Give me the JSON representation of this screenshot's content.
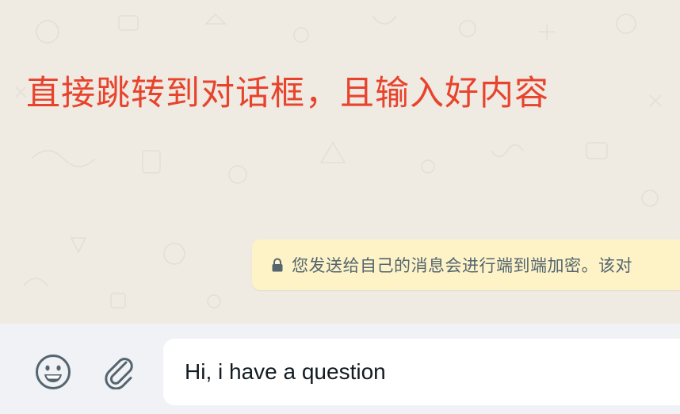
{
  "annotation": {
    "text": "直接跳转到对话框，且输入好内容",
    "color": "#e8432d"
  },
  "system_notice": {
    "icon": "lock-icon",
    "text": "您发送给自己的消息会进行端到端加密。该对"
  },
  "composer": {
    "emoji_icon": "emoji-icon",
    "attach_icon": "paperclip-icon",
    "message_value": "Hi, i have a question"
  },
  "colors": {
    "chat_background": "#efeae2",
    "notice_background": "#fdf3c7",
    "composer_background": "#f0f2f5",
    "icon_gray": "#54656f"
  }
}
